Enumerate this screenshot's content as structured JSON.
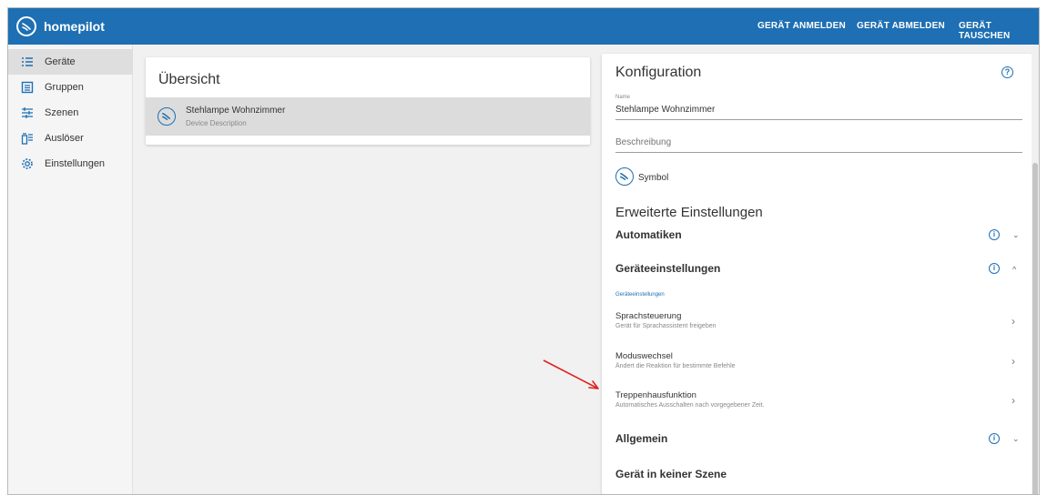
{
  "header": {
    "brand": "homepilot",
    "actions": [
      "GERÄT ANMELDEN",
      "GERÄT ABMELDEN",
      "GERÄT TAUSCHEN"
    ]
  },
  "sidebar": {
    "items": [
      {
        "label": "Geräte",
        "icon": "list-icon",
        "active": true
      },
      {
        "label": "Gruppen",
        "icon": "group-icon",
        "active": false
      },
      {
        "label": "Szenen",
        "icon": "sliders-icon",
        "active": false
      },
      {
        "label": "Auslöser",
        "icon": "trigger-icon",
        "active": false
      },
      {
        "label": "Einstellungen",
        "icon": "gear-icon",
        "active": false
      }
    ]
  },
  "overview": {
    "title": "Übersicht",
    "device_name": "Stehlampe Wohnzimmer",
    "device_description": "Device Description"
  },
  "config": {
    "title": "Konfiguration",
    "help_glyph": "?",
    "name_label": "Name",
    "name_value": "Stehlampe Wohnzimmer",
    "description_placeholder": "Beschreibung",
    "symbol_label": "Symbol",
    "advanced_heading": "Erweiterte Einstellungen",
    "info_glyph": "i",
    "accordions": {
      "automatiken": "Automatiken",
      "geraeteeinstellungen": "Geräteeinstellungen",
      "allgemein": "Allgemein",
      "szene": "Gerät in keiner Szene"
    },
    "settings_sublabel": "Geräteeinstellungen",
    "settings": [
      {
        "title": "Sprachsteuerung",
        "subtitle": "Gerät für Sprachassistent freigeben"
      },
      {
        "title": "Moduswechsel",
        "subtitle": "Ändert die Reaktion für bestimmte Befehle"
      },
      {
        "title": "Treppenhausfunktion",
        "subtitle": "Automatisches Ausschalten nach vorgegebener Zeit."
      }
    ],
    "chevron_down": "⌄",
    "chevron_up": "^",
    "chevron_right": "›"
  },
  "colors": {
    "brand_blue": "#1e6fb3",
    "annotation_arrow": "#e0201f"
  }
}
